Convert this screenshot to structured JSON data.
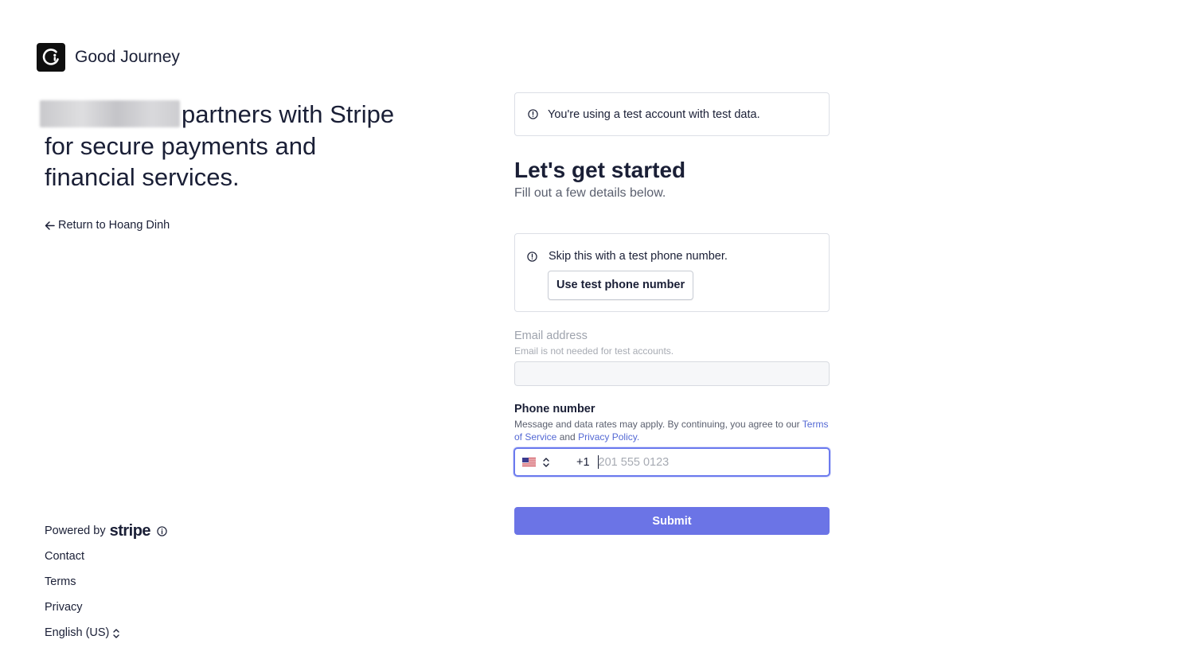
{
  "brand": {
    "name": "Good Journey"
  },
  "headline": {
    "line1": "partners with Stripe",
    "line2": "for secure payments and",
    "line3": "financial services."
  },
  "return_link": {
    "label": "Return to Hoang Dinh"
  },
  "footer": {
    "powered_by": "Powered by",
    "stripe_word": "stripe",
    "links": [
      "Contact",
      "Terms",
      "Privacy"
    ],
    "language": "English (US)"
  },
  "notice": {
    "text": "You're using a test account with test data."
  },
  "form": {
    "title": "Let's get started",
    "subtitle": "Fill out a few details below.",
    "test_box": {
      "text": "Skip this with a test phone number.",
      "button": "Use test phone number"
    },
    "email": {
      "label": "Email address",
      "help": "Email is not needed for test accounts."
    },
    "phone": {
      "label": "Phone number",
      "help_prefix": "Message and data rates may apply. By continuing, you agree to our",
      "terms_link": "Terms of Service",
      "and": "and",
      "privacy_link": "Privacy Policy",
      "help_suffix": ".",
      "dial_code": "+1",
      "placeholder": "201 555 0123"
    },
    "submit": "Submit"
  },
  "colors": {
    "accent": "#6b74e6",
    "link": "#5469d4",
    "focus_border": "#6b7aee",
    "text": "#1a1f36"
  }
}
